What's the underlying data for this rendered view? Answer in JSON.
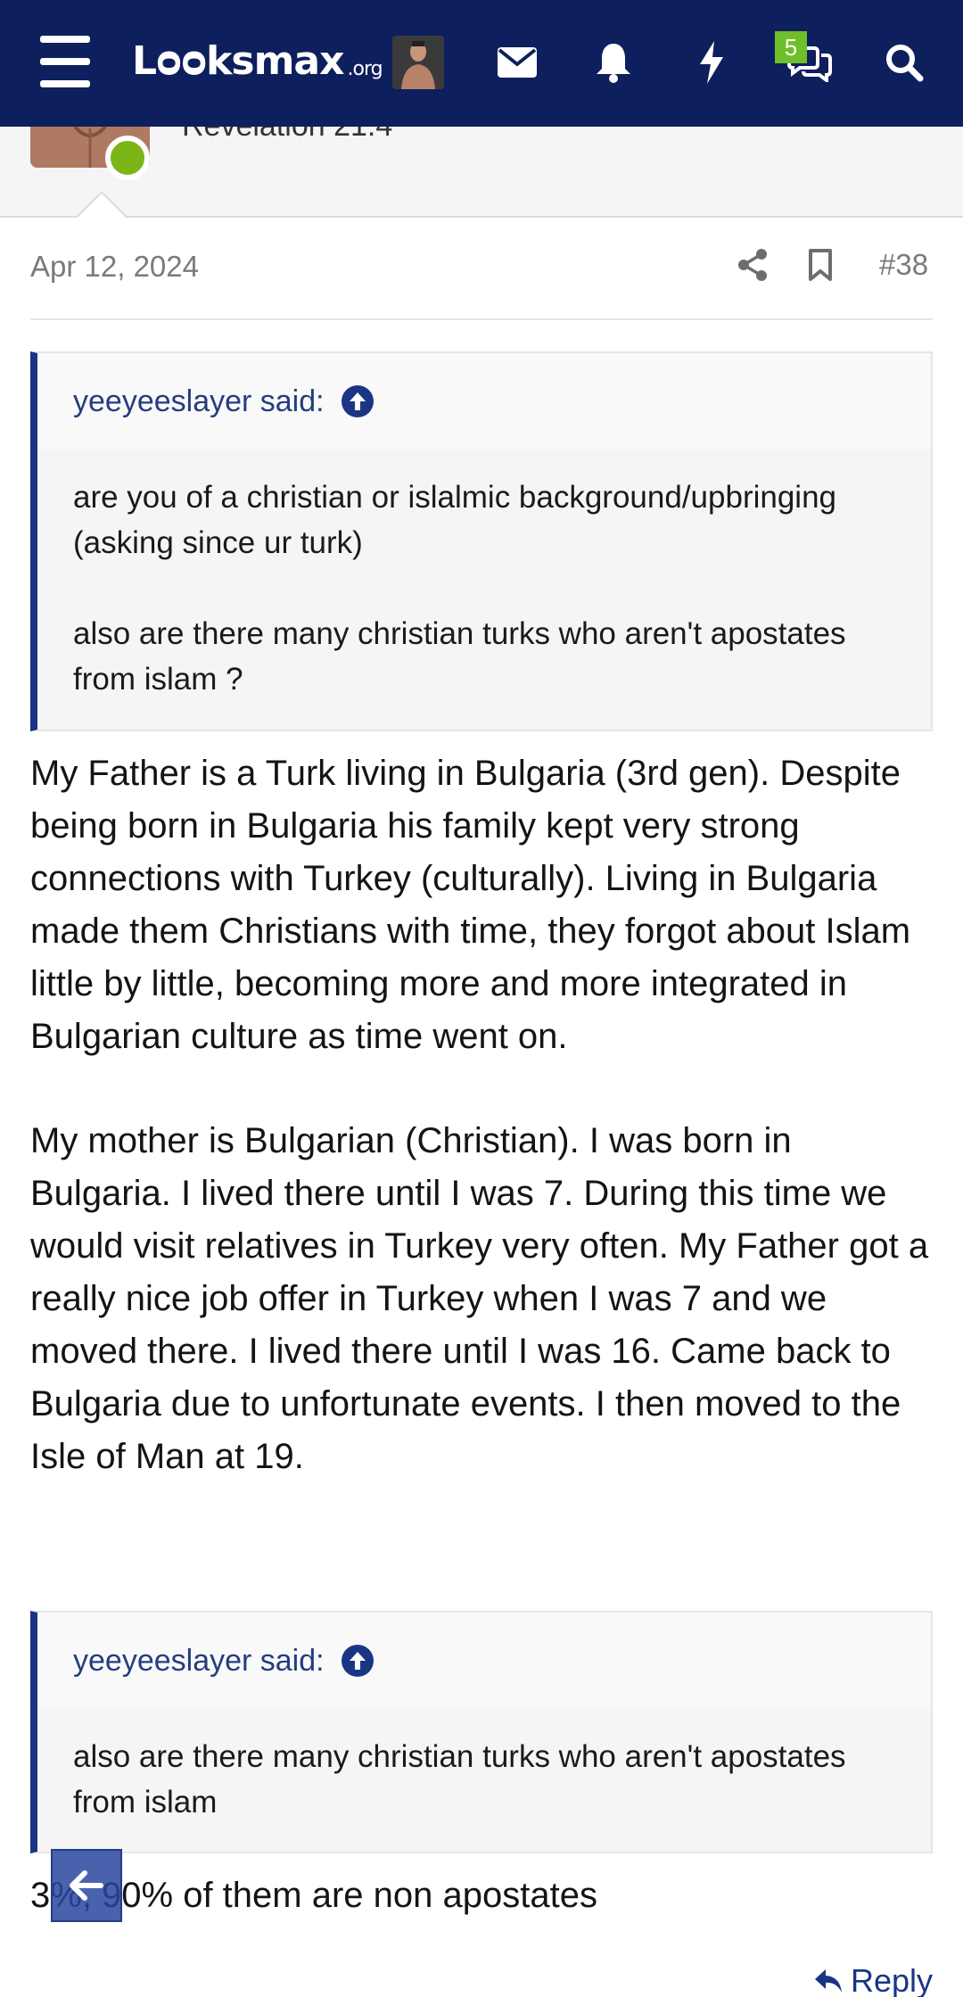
{
  "nav": {
    "logo_main": "Lᴑᴑksmax",
    "logo_suffix": ".org",
    "chat_badge": "5",
    "icons": [
      "menu-icon",
      "avatar",
      "mail-icon",
      "bell-icon",
      "bolt-icon",
      "chat-icon",
      "search-icon"
    ],
    "accent": "#0d1f5c"
  },
  "member": {
    "title": "Revelation 21:4",
    "online_color": "#7cb518"
  },
  "post": {
    "date": "Apr 12, 2024",
    "number": "#38",
    "quote1": {
      "author": "yeeyeeslayer said:",
      "p1": "are you of a christian or islalmic background/upbringing (asking since ur turk)",
      "p2": "also are there many christian turks who aren't apostates from islam ?"
    },
    "text1": "My Father is a Turk living in Bulgaria (3rd gen). Despite being born in Bulgaria his family kept very strong connections with Turkey (culturally). Living in Bulgaria made them Christians with time, they forgot about Islam little by little, becoming more and more integrated in Bulgarian culture as time went on.",
    "text2": "My mother is Bulgarian (Christian). I was born in Bulgaria. I lived there until I was 7. During this time we would visit relatives in Turkey very often. My Father got a really nice job offer in Turkey when I was 7 and we moved there. I lived there until I was 16. Came back to Bulgaria due to unfortunate events. I then moved to the Isle of Man at 19.",
    "quote2": {
      "author": "yeeyeeslayer said:",
      "p1": "also are there many christian turks who aren't apostates from islam"
    },
    "text3": "3%, 90% of them are non apostates",
    "reply_label": "Reply"
  }
}
